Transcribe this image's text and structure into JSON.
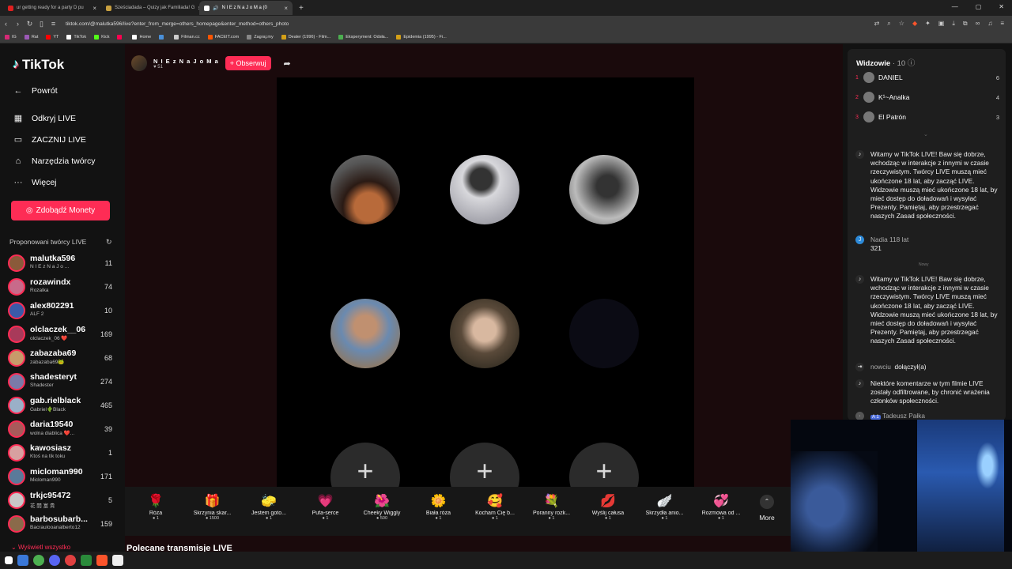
{
  "browser": {
    "tabs": [
      {
        "title": "ur getting ready for a party D pu",
        "color": "#e02020"
      },
      {
        "title": "Sześciadada – Quizy jak Familiada! G",
        "color": "#c8a040"
      },
      {
        "title": "N I E z N a J o M a  (0",
        "color": "#ffffff",
        "active": true
      }
    ],
    "new_tab": "+",
    "url": "tiktok.com/@malutka596/live?enter_from_merge=others_homepage&enter_method=others_photo",
    "bookmarks": [
      {
        "label": "IG",
        "color": "#d62976"
      },
      {
        "label": "Rat",
        "color": "#9b59b6"
      },
      {
        "label": "YT",
        "color": "#ff0000"
      },
      {
        "label": "TikTok",
        "color": "#ffffff"
      },
      {
        "label": "Kick",
        "color": "#53fc18"
      },
      {
        "label": "",
        "color": "#ff0050"
      },
      {
        "label": "Home",
        "color": "#ffffff"
      },
      {
        "label": "",
        "color": "#4a90d9"
      },
      {
        "label": "Filman.cc",
        "color": "#cccccc"
      },
      {
        "label": "FACEIT.com",
        "color": "#ff5500"
      },
      {
        "label": "Zagraj.my",
        "color": "#888888"
      },
      {
        "label": "Dealer (1996) - Film...",
        "color": "#d4a017"
      },
      {
        "label": "Eksperyment: Odsła...",
        "color": "#4caf50"
      },
      {
        "label": "Epidemia (1995) - Fi...",
        "color": "#d4a017"
      }
    ]
  },
  "sidebar": {
    "logo": "TikTok",
    "back": "Powrót",
    "nav": [
      "Odkryj LIVE",
      "ZACZNIJ LIVE",
      "Narzędzia twórcy",
      "Więcej"
    ],
    "coins_button": "Zdobądź Monety",
    "suggested_title": "Proponowani twórcy LIVE",
    "creators": [
      {
        "name": "malutka596",
        "sub": "N I E z N a J o ...",
        "count": "11"
      },
      {
        "name": "rozawindx",
        "sub": "Rozalka",
        "count": "74"
      },
      {
        "name": "alex802291",
        "sub": "ALF 2",
        "count": "10"
      },
      {
        "name": "olclaczek__06",
        "sub": "olclaczek_06 ❤️",
        "count": "169"
      },
      {
        "name": "zabazaba69",
        "sub": "zabazaba69🐸",
        "count": "68"
      },
      {
        "name": "shadesteryt",
        "sub": "Shadester",
        "count": "274"
      },
      {
        "name": "gab.rielblack",
        "sub": "Gabriel🌵Black",
        "count": "465"
      },
      {
        "name": "daria19540",
        "sub": "wolna diablica ❤️...",
        "count": "39"
      },
      {
        "name": "kawosiasz",
        "sub": "Ktoś na tik toku",
        "count": "1"
      },
      {
        "name": "micloman990",
        "sub": "Micloman990",
        "count": "171"
      },
      {
        "name": "trkjc95472",
        "sub": "花 開 富 貴",
        "count": "5"
      },
      {
        "name": "barbosubarb...",
        "sub": "Bacraulooanalberto12",
        "count": "159"
      }
    ],
    "show_all": "Wyświetl wszystko"
  },
  "stream": {
    "host_name": "N I E z N a J o M a",
    "likes": "51",
    "follow_button": "+ Obserwuj",
    "gifts": [
      {
        "icon": "🌹",
        "name": "Róża",
        "price": "1"
      },
      {
        "icon": "🎁",
        "name": "Skrzynia skar...",
        "price": "1500"
      },
      {
        "icon": "🧽",
        "name": "Jestem goto...",
        "price": "1"
      },
      {
        "icon": "💗",
        "name": "Pufa-serce",
        "price": "1"
      },
      {
        "icon": "🌺",
        "name": "Cheeky Wiggly",
        "price": "500"
      },
      {
        "icon": "🌼",
        "name": "Biała róża",
        "price": "1"
      },
      {
        "icon": "🥰",
        "name": "Kocham Cię b...",
        "price": "1"
      },
      {
        "icon": "💐",
        "name": "Poranny rozk...",
        "price": "1"
      },
      {
        "icon": "💋",
        "name": "Wyślij całusa",
        "price": "1"
      },
      {
        "icon": "🪽",
        "name": "Skrzydła anio...",
        "price": "1"
      },
      {
        "icon": "💞",
        "name": "Rozmowa od ...",
        "price": "1"
      }
    ],
    "more": "More",
    "recommended": "Polecane transmisje LIVE"
  },
  "viewers": {
    "title": "Widzowie",
    "count": "· 10",
    "top": [
      {
        "rank": "1",
        "name": "DANIEL",
        "count": "6"
      },
      {
        "rank": "2",
        "name": "K¹~Analka",
        "count": "4"
      },
      {
        "rank": "3",
        "name": "El Patrón",
        "count": "3"
      }
    ]
  },
  "chat": {
    "welcome": "Witamy w TikTok LIVE! Baw się dobrze, wchodząc w interakcje z innymi w czasie rzeczywistym. Twórcy LIVE muszą mieć ukończone 18 lat, aby zacząć LIVE. Widzowie muszą mieć ukończone 18 lat, by mieć dostęp do doładowań i wysyłać Prezenty. Pamiętaj, aby przestrzegać naszych Zasad społeczności.",
    "msg_user": "Nadia 118 lat",
    "msg_text": "321",
    "new_divider": "Nowy",
    "joined_user": "nowciu",
    "joined_text": "dołączył(a)",
    "filter_note": "Niektóre komentarze w tym filmie LIVE zostały odfiltrowane, by chronić wrażenia członków społeczności.",
    "last_user": "Tadeusz Pałka",
    "last_badge": "A 1"
  }
}
